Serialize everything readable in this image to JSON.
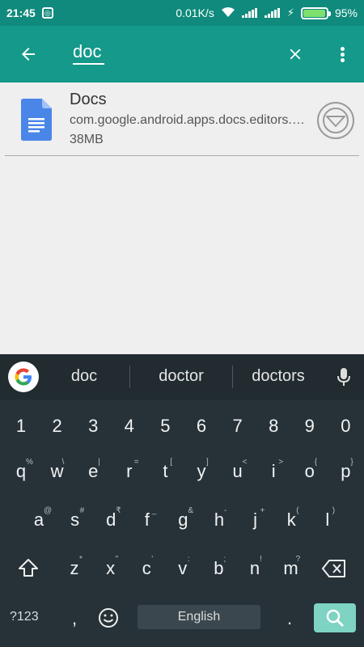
{
  "status_bar": {
    "time": "21:45",
    "network_speed": "0.01K/s",
    "battery_percent": "95%",
    "battery_level": 0.95
  },
  "app_bar": {
    "search_query": "doc"
  },
  "results": [
    {
      "name": "Docs",
      "package": "com.google.android.apps.docs.editors.docs",
      "size": "38MB"
    }
  ],
  "keyboard": {
    "suggestions": [
      "doc",
      "doctor",
      "doctors"
    ],
    "number_row": [
      "1",
      "2",
      "3",
      "4",
      "5",
      "6",
      "7",
      "8",
      "9",
      "0"
    ],
    "row1": [
      "q",
      "w",
      "e",
      "r",
      "t",
      "y",
      "u",
      "i",
      "o",
      "p"
    ],
    "row1_alt": [
      "%",
      "\\",
      "|",
      "=",
      "[",
      "]",
      "<",
      ">",
      "{",
      "}"
    ],
    "row2": [
      "a",
      "s",
      "d",
      "f",
      "g",
      "h",
      "j",
      "k",
      "l"
    ],
    "row2_alt": [
      "@",
      "#",
      "₹",
      "_",
      "&",
      "-",
      "+",
      "(",
      ")"
    ],
    "row3": [
      "z",
      "x",
      "c",
      "v",
      "b",
      "n",
      "m"
    ],
    "row3_alt": [
      "*",
      "\"",
      "'",
      ":",
      ";",
      "!",
      "?"
    ],
    "symbols_label": "?123",
    "comma": ",",
    "period": ".",
    "space_label": "English"
  }
}
